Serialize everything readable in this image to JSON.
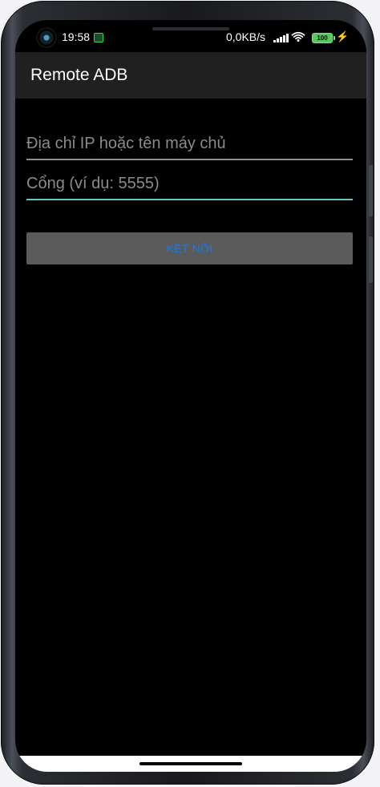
{
  "status_bar": {
    "time": "19:58",
    "network_speed": "0,0KB/s",
    "battery_level": "100",
    "icons": [
      "camera-icon",
      "app-notification-icon",
      "signal-icon",
      "wifi-icon",
      "battery-icon",
      "charging-icon"
    ]
  },
  "app_bar": {
    "title": "Remote ADB"
  },
  "form": {
    "ip_placeholder": "Địa chỉ IP hoặc tên máy chủ",
    "port_placeholder": "Cổng (ví dụ: 5555)",
    "connect_label": "KẾT NỐI"
  },
  "colors": {
    "background": "#000000",
    "app_bar": "#202020",
    "button_bg": "#5b5b5b",
    "button_text": "#0f7cf0",
    "focused_line": "#67c6c1",
    "battery": "#59c65e"
  }
}
